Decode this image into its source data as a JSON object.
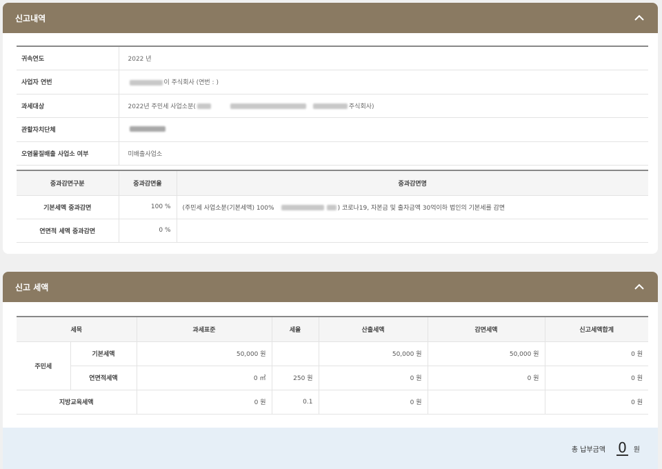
{
  "report": {
    "title": "신고내역",
    "rows": [
      {
        "label": "귀속연도",
        "value": "2022 년"
      },
      {
        "label": "사업자 연번",
        "value": "이 주식회사 (연번 : )"
      },
      {
        "label": "과세대상",
        "value": "2022년 주민세 사업소분(",
        "value_end": "주식회사)"
      },
      {
        "label": "관할자치단체",
        "value": ""
      },
      {
        "label": "오염물질배출 사업소 여부",
        "value": "미배출사업소"
      }
    ],
    "reduction": {
      "headers": [
        "중과감면구분",
        "중과감면율",
        "중과감면명"
      ],
      "rows": [
        {
          "type": "기본세액 중과감면",
          "rate": "100 %",
          "name_start": "(주민세 사업소분(기본세액) 100%",
          "name_end": ") 코로나19, 자본금 및 출자금액 30억이하 법인의 기본세를 감면"
        },
        {
          "type": "연면적 세액 중과감면",
          "rate": "0 %",
          "name_start": "",
          "name_end": ""
        }
      ]
    }
  },
  "tax": {
    "title": "신고 세액",
    "headers": [
      "세목",
      "과세표준",
      "세율",
      "산출세액",
      "감면세액",
      "신고세액합계"
    ],
    "group": "주민세",
    "rows": [
      {
        "sub": "기본세액",
        "base": "50,000 원",
        "rate": "",
        "calc": "50,000 원",
        "reduce": "50,000 원",
        "total": "0 원"
      },
      {
        "sub": "연면적세액",
        "base": "0 ㎡",
        "rate": "250 원",
        "calc": "0 원",
        "reduce": "0 원",
        "total": "0 원"
      },
      {
        "sub": "지방교육세액",
        "base": "0 원",
        "rate": "0.1",
        "calc": "0 원",
        "reduce": "",
        "total": "0 원"
      }
    ],
    "total_label": "총 납부금액",
    "total_value": "0",
    "total_unit": "원"
  },
  "icons": {
    "collapse": "chevron-up-icon"
  },
  "colors": {
    "header_bg": "#8a7a62",
    "total_bg": "#e6eff7"
  }
}
